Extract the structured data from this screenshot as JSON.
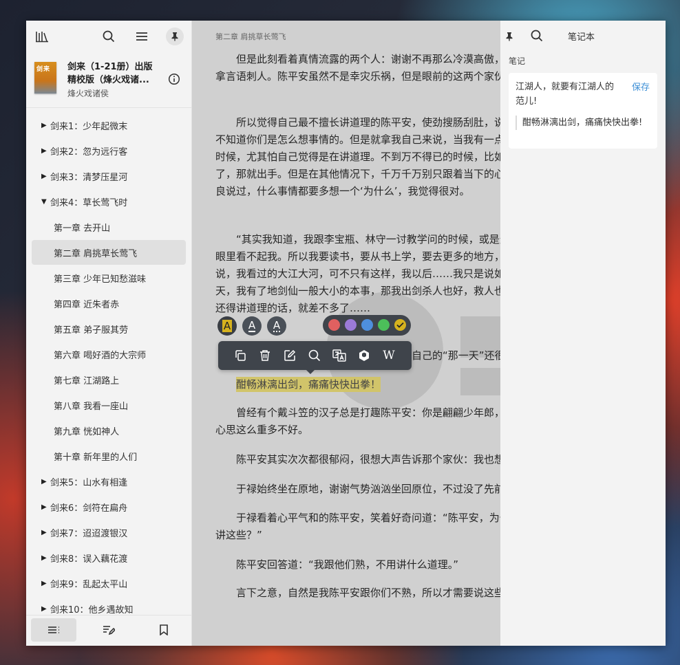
{
  "sidebar": {
    "book": {
      "cover_text": "剑来",
      "title": "剑来（1-21册）出版精校版（烽火戏诸...",
      "author": "烽火戏诸侯"
    },
    "toc": [
      {
        "label": "剑来1：少年起微末",
        "level": 0,
        "expanded": false
      },
      {
        "label": "剑来2：忽为远行客",
        "level": 0,
        "expanded": false
      },
      {
        "label": "剑来3：清梦压星河",
        "level": 0,
        "expanded": false
      },
      {
        "label": "剑来4：草长莺飞时",
        "level": 0,
        "expanded": true
      },
      {
        "label": "第一章 去开山",
        "level": 1
      },
      {
        "label": "第二章 肩挑草长莺飞",
        "level": 1,
        "active": true
      },
      {
        "label": "第三章 少年已知愁滋味",
        "level": 1
      },
      {
        "label": "第四章 近朱者赤",
        "level": 1
      },
      {
        "label": "第五章 弟子服其劳",
        "level": 1
      },
      {
        "label": "第六章 喝好酒的大宗师",
        "level": 1
      },
      {
        "label": "第七章 江湖路上",
        "level": 1
      },
      {
        "label": "第八章 我看一座山",
        "level": 1
      },
      {
        "label": "第九章 恍如神人",
        "level": 1
      },
      {
        "label": "第十章 新年里的人们",
        "level": 1
      },
      {
        "label": "剑来5：山水有相逢",
        "level": 0,
        "expanded": false
      },
      {
        "label": "剑来6：剑符在扁舟",
        "level": 0,
        "expanded": false
      },
      {
        "label": "剑来7：迢迢渡银汉",
        "level": 0,
        "expanded": false
      },
      {
        "label": "剑来8：误入藕花渡",
        "level": 0,
        "expanded": false
      },
      {
        "label": "剑来9：乱起太平山",
        "level": 0,
        "expanded": false
      },
      {
        "label": "剑来10：他乡遇故知",
        "level": 0,
        "expanded": false
      }
    ]
  },
  "reader": {
    "chapter_header": "第二章 肩挑草长莺飞",
    "paragraphs": [
      "但是此刻看着真情流露的两个人：谢谢不再那么冷漠高傲，于禄不再那么和和气气，会拿言语刺人。陈平安虽然不是幸灾乐祸，但是眼前的这两个家伙，有了些自己熟悉的人气。",
      "所以觉得自己最不擅长讲道理的陈平安，使劲搜肠刮肚，说道：“你们学问大多了，我不知道你们是怎么想事情的。但是就拿我自己来说，当我有一点本事，能够决定别人命运的时候，尤其怕自己觉得是在讲道理。不到万不得已的时候，比如生死关头，什么都没得讲了，那就出手。但是在其他情况下，千万千万别只跟着当下的心思走，被心牵着鼻子走。阿良说过，什么事情都要多想一个‘为什么’，我觉得很对。",
      "“其实我知道，我跟李宝瓶、林守一讨教学问的时候，或是遇上不懂的时候，你们打心眼里看不起我。所以我要读书，要从书上学，要去更多的地方，就像阿良那样，敢拍着胸脯说，我看过的大江大河，可不只有这样，我以后……我只是说如果、万一啊，真有那么一天，我有了地剑仙一般大小的本事，那我出剑杀人也好，救人也罢，一剑递出，是对是错，还得讲道理的话，就差不多了……",
      "陈平安说着说着，好像自己都意识到了自己的“那一天”还很远。",
      "酣畅淋漓出剑，痛痛快快出拳！",
      "曾经有个戴斗笠的汉子总是打趣陈平安：你是翩翩少年郎，能不能别这么老气横秋行？心思这么重多不好。",
      "陈平安其实次次都很郁闷，很想大声告诉那个家伙：我也想啊。",
      "于禄始终坐在原地，谢谢气势汹汹坐回原位，不过没了先前的气焰。",
      "于禄看着心平气和的陈平安，笑着好奇问道：“陈平安，为什么李宝瓶、李槐他们从不讲这些？”",
      "陈平安回答道：“我跟他们熟，不用讲什么道理。”",
      "言下之意，自然是我陈平安跟你们不熟，所以才需要说这些。"
    ],
    "selection_toolbar": {
      "styles": [
        "A",
        "A",
        "A"
      ],
      "colors": [
        "#e06060",
        "#9b7ad8",
        "#4e8fdc",
        "#4cbf5a",
        "#d6b21e"
      ],
      "actions": [
        "copy-icon",
        "trash-icon",
        "edit-note-icon",
        "search-icon",
        "translate-icon",
        "dictionary-icon",
        "wikipedia-icon"
      ],
      "wiki_glyph": "W"
    }
  },
  "notes": {
    "title": "笔记本",
    "section_label": "笔记",
    "card": {
      "text": "江湖人，就要有江湖人的范儿!",
      "save_label": "保存",
      "quote": "酣畅淋漓出剑，痛痛快快出拳!"
    }
  }
}
